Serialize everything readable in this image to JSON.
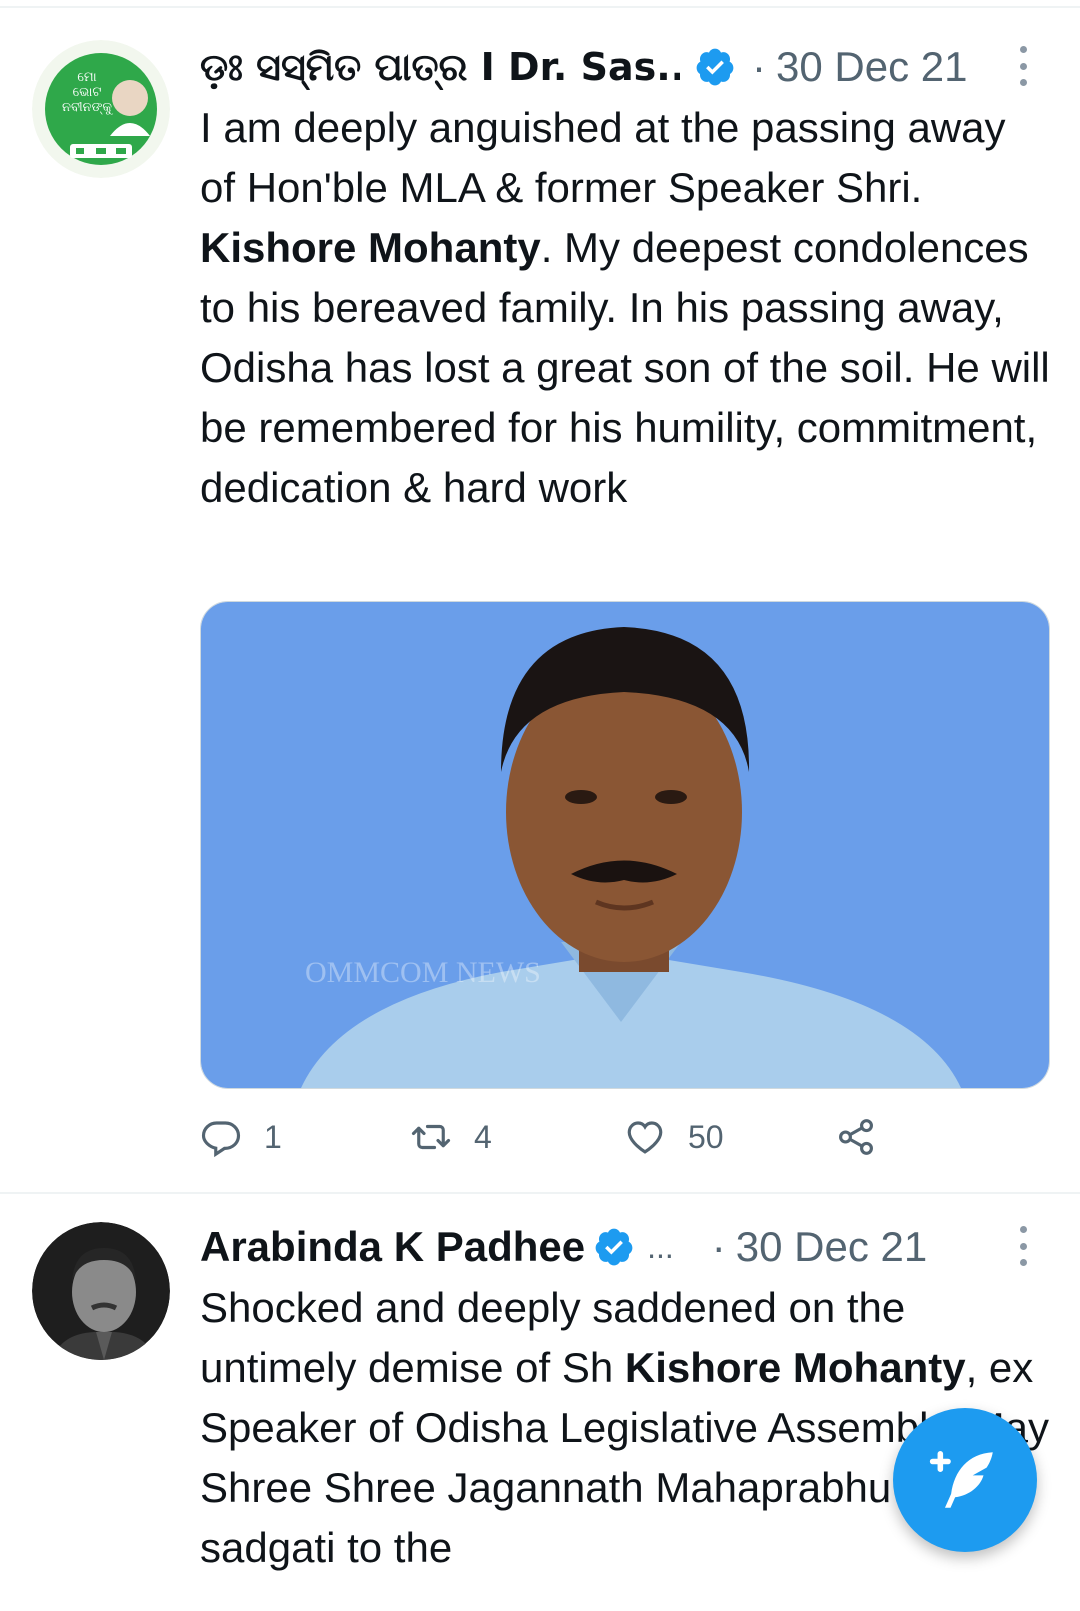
{
  "tweets": [
    {
      "author": "ଡ଼଼ଃ ସସ୍ମିତ ପାତ୍ର I Dr. Sas...",
      "date": "30 Dec 21",
      "separator": "·",
      "avatar_text": [
        "ମୋ",
        "ଭୋଟ",
        "ନବୀନଙ୍କୁ"
      ],
      "text": {
        "p1": "I am deeply anguished at the passing away of Hon'ble MLA & former Speaker Shri. ",
        "bold": "Kishore Mohanty",
        "p2": ". My deepest condolences to his bereaved family. In his passing away, Odisha has lost a great son of the soil. He will be remembered for his humility, commitment, dedication & hard work"
      },
      "media_watermark": "OMMCOM NEWS",
      "actions": {
        "replies": "1",
        "retweets": "4",
        "likes": "50"
      }
    },
    {
      "author": "Arabinda K Padhee",
      "ellipsis": "...",
      "date": "30 Dec 21",
      "separator": "·",
      "text": {
        "p1": "Shocked and deeply saddened on the untimely demise of Sh ",
        "bold": "Kishore Mohanty",
        "p2": ", ex Speaker of Odisha Legislative Assembly. May Shree Shree Jagannath Mahaprabhu grant sadgati to the"
      }
    }
  ],
  "icons": {
    "verified": "verified-badge-icon",
    "more": "more-vertical-icon",
    "reply": "reply-icon",
    "retweet": "retweet-icon",
    "like": "heart-icon",
    "share": "share-icon",
    "compose": "compose-tweet-icon"
  },
  "colors": {
    "accent": "#1d9bf0",
    "muted": "#536471",
    "text": "#0f1419",
    "media_bg": "#6a9eea"
  }
}
